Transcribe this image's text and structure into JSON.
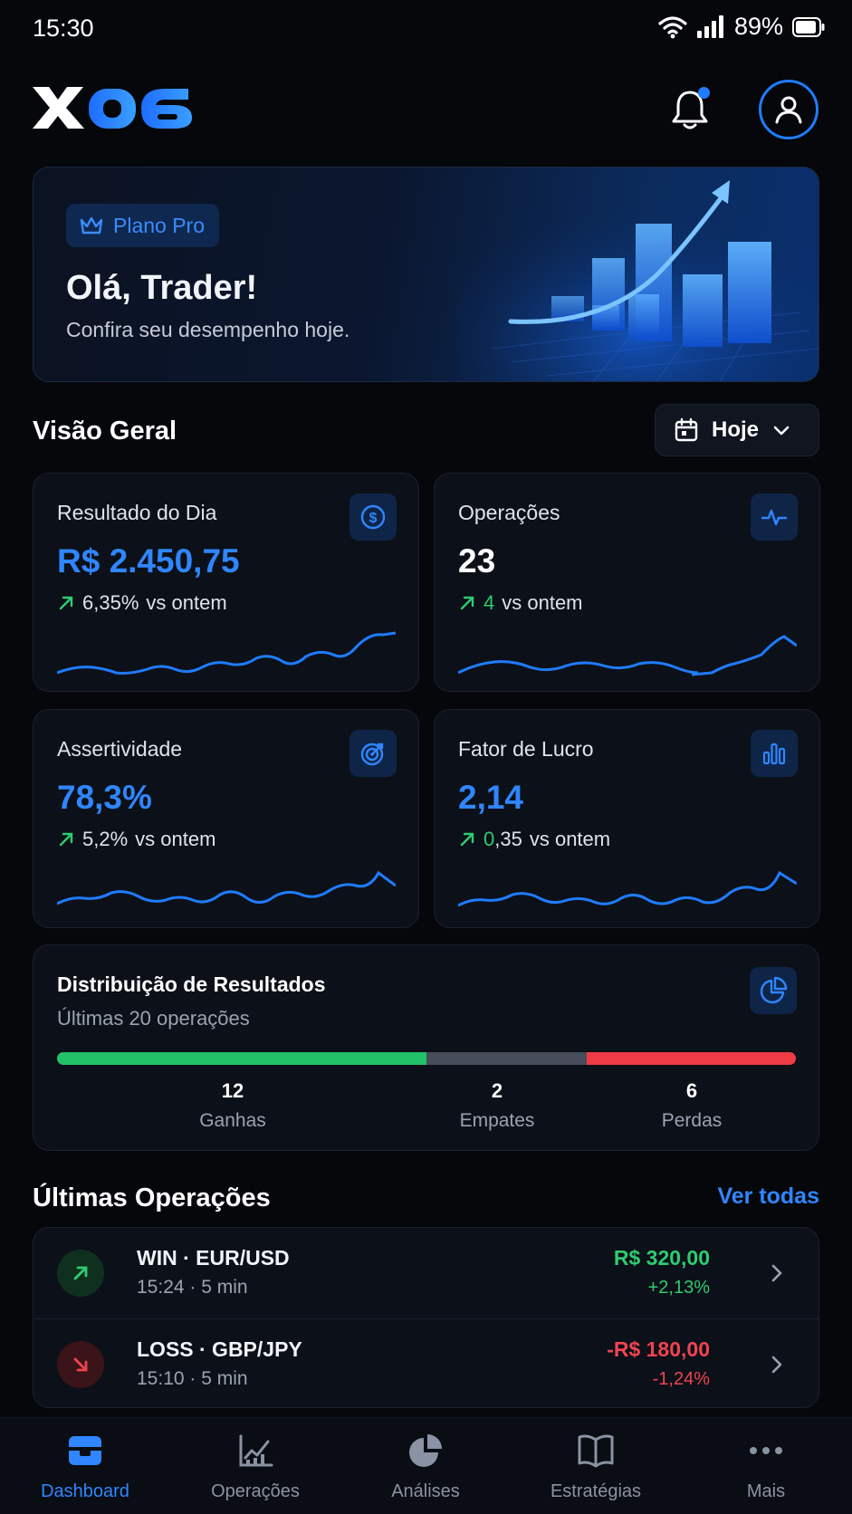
{
  "status_bar": {
    "time": "15:30",
    "battery": "89%"
  },
  "header": {
    "logo_text": "X06"
  },
  "hero": {
    "plan": "Plano Pro",
    "greeting": "Olá, Trader!",
    "subtitle": "Confira seu desempenho hoje."
  },
  "overview": {
    "title": "Visão Geral",
    "period": "Hoje",
    "cards": [
      {
        "label": "Resultado do Dia",
        "value": "R$ 2.450,75",
        "delta": "6,35%",
        "delta_suffix": "vs ontem",
        "icon": "dollar-circle-icon"
      },
      {
        "label": "Operações",
        "value": "23",
        "delta": "4",
        "delta_suffix": "vs ontem",
        "icon": "activity-icon"
      },
      {
        "label": "Assertividade",
        "value": "78,3%",
        "delta": "5,2%",
        "delta_suffix": "vs ontem",
        "icon": "target-icon"
      },
      {
        "label": "Fator de Lucro",
        "value": "2,14",
        "delta_int": "0",
        "delta_dec": ",35",
        "delta_suffix": "vs ontem",
        "icon": "bar-chart-icon"
      }
    ]
  },
  "distribution": {
    "title": "Distribuição de Resultados",
    "subtitle": "Últimas 20 operações",
    "wins": "12",
    "wins_label": "Ganhas",
    "ties": "2",
    "ties_label": "Empates",
    "losses": "6",
    "losses_label": "Perdas"
  },
  "latest": {
    "title": "Últimas Operações",
    "see_all": "Ver todas",
    "items": [
      {
        "title": "WIN · EUR/USD",
        "meta": "15:24 · 5 min",
        "amount": "R$ 320,00",
        "pct": "+2,13%"
      },
      {
        "title": "LOSS · GBP/JPY",
        "meta": "15:10 · 5 min",
        "amount": "-R$ 180,00",
        "pct": "-1,24%"
      }
    ]
  },
  "nav": [
    "Dashboard",
    "Operações",
    "Análises",
    "Estratégias",
    "Mais"
  ],
  "colors": {
    "accent": "#1f7cff",
    "win": "#22c268",
    "loss": "#ef3b45",
    "tie": "#474d59"
  }
}
